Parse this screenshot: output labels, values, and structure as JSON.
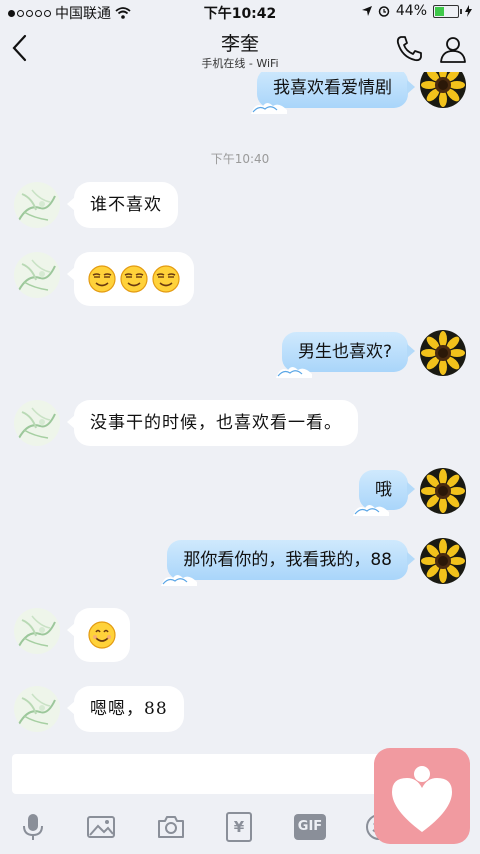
{
  "status_bar": {
    "carrier": "中国联通",
    "time": "下午10:42",
    "battery_pct": "44%",
    "battery_level": 0.44
  },
  "header": {
    "title": "李奎",
    "subtitle": "手机在线 - WiFi"
  },
  "timestamp": "下午10:40",
  "messages": [
    {
      "side": "right",
      "text": "我喜欢看爱情剧"
    },
    {
      "side": "left",
      "text": "谁不喜欢"
    },
    {
      "side": "left",
      "emojis": [
        "smirk-emoji",
        "smirk-emoji",
        "smirk-emoji"
      ]
    },
    {
      "side": "right",
      "text": "男生也喜欢?"
    },
    {
      "side": "left",
      "text": "没事干的时候，也喜欢看一看。"
    },
    {
      "side": "right",
      "text": "哦"
    },
    {
      "side": "right",
      "text": "那你看你的，我看我的，88"
    },
    {
      "side": "left",
      "emojis": [
        "smile-emoji"
      ]
    },
    {
      "side": "left",
      "text": "嗯嗯，88"
    }
  ],
  "toolbar": {
    "icons": [
      "microphone-icon",
      "image-icon",
      "camera-icon",
      "red-packet-icon",
      "gif-icon",
      "emoji-icon"
    ],
    "gif_label": "GIF",
    "red_packet_label": "¥"
  },
  "colors": {
    "background": "#eef0f5",
    "bubble_right": "#a9d5fa",
    "bubble_left": "#ffffff",
    "app_overlay": "#f19aa0"
  }
}
